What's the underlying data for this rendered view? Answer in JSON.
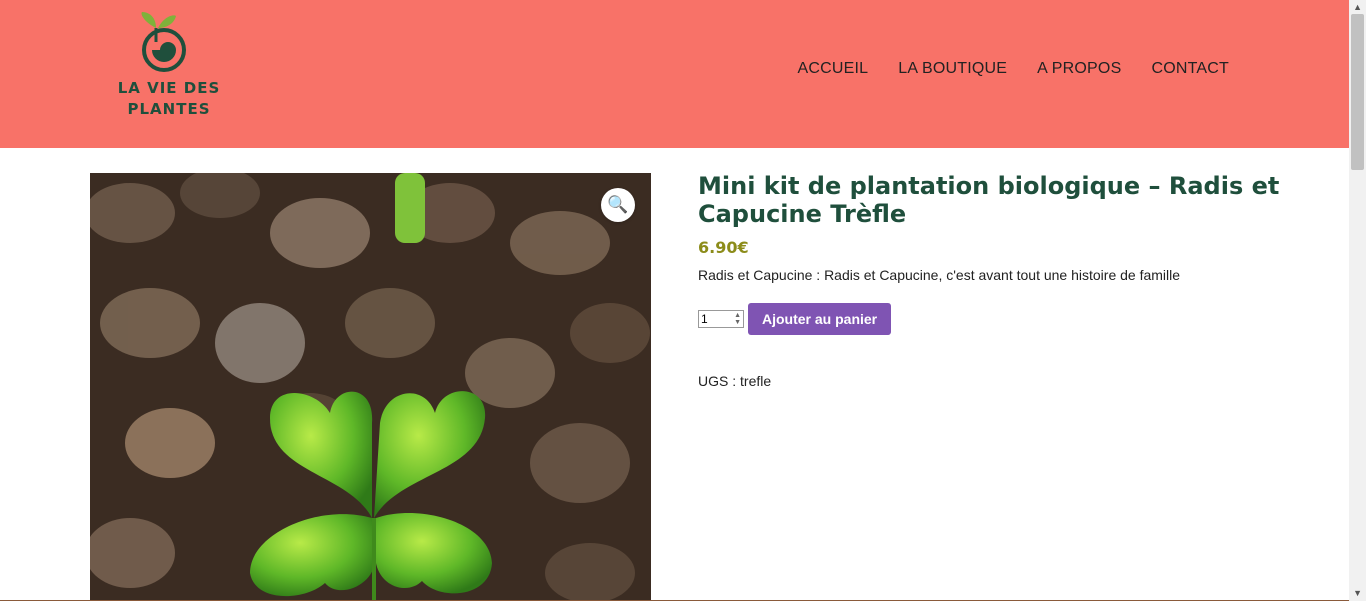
{
  "brand": {
    "line1": "LA VIE DES",
    "line2": "PLANTES"
  },
  "nav": [
    {
      "label": "ACCUEIL"
    },
    {
      "label": "LA BOUTIQUE"
    },
    {
      "label": "A PROPOS"
    },
    {
      "label": "CONTACT"
    }
  ],
  "product": {
    "title": "Mini kit de plantation biologique – Radis et Capucine Trèfle",
    "price": "6.90€",
    "short_description": "Radis et Capucine : Radis et Capucine, c'est avant tout une histoire de famille",
    "quantity": "1",
    "add_to_cart_label": "Ajouter au panier",
    "sku_label": "UGS :",
    "sku_value": "trefle",
    "image_icon": "zoom-magnifier-icon"
  },
  "colors": {
    "header_bg": "#f87268",
    "brand_green": "#1f4f3c",
    "price_color": "#8c8c1a",
    "button_purple": "#7f54b3"
  }
}
